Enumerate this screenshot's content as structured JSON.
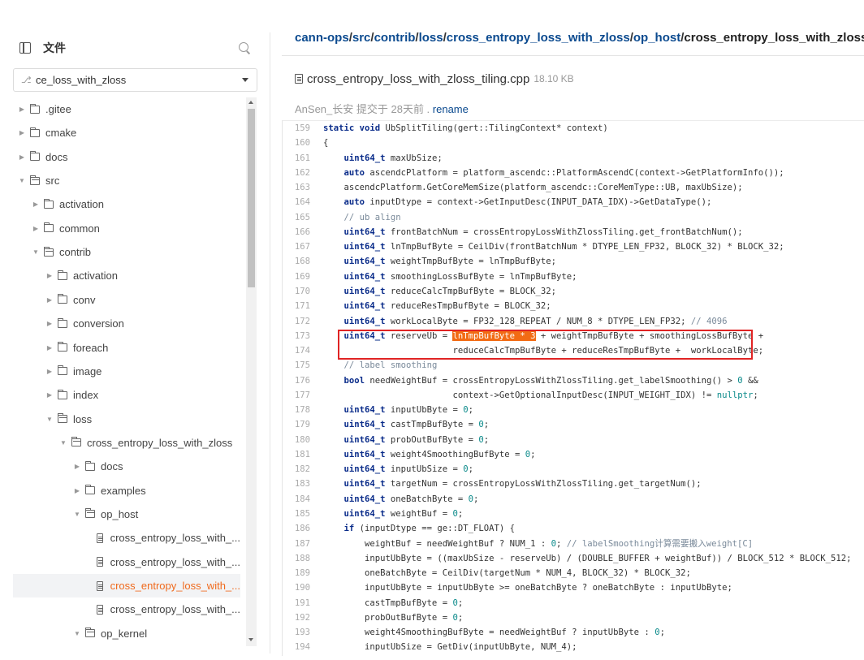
{
  "sidebar": {
    "title": "文件",
    "branch": "ce_loss_with_zloss",
    "tree": [
      {
        "label": ".gitee",
        "type": "folder",
        "open": false,
        "depth": 0
      },
      {
        "label": "cmake",
        "type": "folder",
        "open": false,
        "depth": 0
      },
      {
        "label": "docs",
        "type": "folder",
        "open": false,
        "depth": 0
      },
      {
        "label": "src",
        "type": "folder",
        "open": true,
        "depth": 0
      },
      {
        "label": "activation",
        "type": "folder",
        "open": false,
        "depth": 1
      },
      {
        "label": "common",
        "type": "folder",
        "open": false,
        "depth": 1
      },
      {
        "label": "contrib",
        "type": "folder",
        "open": true,
        "depth": 1
      },
      {
        "label": "activation",
        "type": "folder",
        "open": false,
        "depth": 2
      },
      {
        "label": "conv",
        "type": "folder",
        "open": false,
        "depth": 2
      },
      {
        "label": "conversion",
        "type": "folder",
        "open": false,
        "depth": 2
      },
      {
        "label": "foreach",
        "type": "folder",
        "open": false,
        "depth": 2
      },
      {
        "label": "image",
        "type": "folder",
        "open": false,
        "depth": 2
      },
      {
        "label": "index",
        "type": "folder",
        "open": false,
        "depth": 2
      },
      {
        "label": "loss",
        "type": "folder",
        "open": true,
        "depth": 2
      },
      {
        "label": "cross_entropy_loss_with_zloss",
        "type": "folder",
        "open": true,
        "depth": 3
      },
      {
        "label": "docs",
        "type": "folder",
        "open": false,
        "depth": 4
      },
      {
        "label": "examples",
        "type": "folder",
        "open": false,
        "depth": 4
      },
      {
        "label": "op_host",
        "type": "folder",
        "open": true,
        "depth": 4
      },
      {
        "label": "cross_entropy_loss_with_...",
        "type": "file",
        "depth": 5
      },
      {
        "label": "cross_entropy_loss_with_...",
        "type": "file",
        "depth": 5
      },
      {
        "label": "cross_entropy_loss_with_...",
        "type": "file",
        "depth": 5,
        "active": true
      },
      {
        "label": "cross_entropy_loss_with_...",
        "type": "file",
        "depth": 5
      },
      {
        "label": "op_kernel",
        "type": "folder",
        "open": true,
        "depth": 4
      }
    ]
  },
  "main": {
    "breadcrumb": [
      "cann-ops",
      "src",
      "contrib",
      "loss",
      "cross_entropy_loss_with_zloss",
      "op_host"
    ],
    "breadcrumb_current": "cross_entropy_loss_with_zloss_tiling.c",
    "file_name": "cross_entropy_loss_with_zloss_tiling.cpp",
    "file_size": "18.10 KB",
    "commit_author_time": "AnSen_长安 提交于 28天前 . ",
    "commit_message": "rename",
    "highlight_text": "lnTmpBufByte * 3",
    "code": [
      {
        "n": "159",
        "t": "<span class=\"kw\">static void</span> UbSplitTiling(gert::TilingContext* context)",
        "i": 0
      },
      {
        "n": "160",
        "t": "{",
        "i": 0
      },
      {
        "n": "161",
        "t": "<span class=\"kw\">uint64_t</span> maxUbSize;",
        "i": 1
      },
      {
        "n": "162",
        "t": "<span class=\"kw\">auto</span> ascendcPlatform = platform_ascendc::PlatformAscendC(context->GetPlatformInfo());",
        "i": 1
      },
      {
        "n": "163",
        "t": "ascendcPlatform.GetCoreMemSize(platform_ascendc::CoreMemType::UB, maxUbSize);",
        "i": 1
      },
      {
        "n": "164",
        "t": "<span class=\"kw\">auto</span> inputDtype = context->GetInputDesc(INPUT_DATA_IDX)->GetDataType();",
        "i": 1
      },
      {
        "n": "165",
        "t": "<span class=\"cm\">// ub align</span>",
        "i": 1
      },
      {
        "n": "166",
        "t": "<span class=\"kw\">uint64_t</span> frontBatchNum = crossEntropyLossWithZlossTiling.get_frontBatchNum();",
        "i": 1
      },
      {
        "n": "167",
        "t": "<span class=\"kw\">uint64_t</span> lnTmpBufByte = CeilDiv(frontBatchNum * DTYPE_LEN_FP32, BLOCK_32) * BLOCK_32;",
        "i": 1
      },
      {
        "n": "168",
        "t": "<span class=\"kw\">uint64_t</span> weightTmpBufByte = lnTmpBufByte;",
        "i": 1
      },
      {
        "n": "169",
        "t": "<span class=\"kw\">uint64_t</span> smoothingLossBufByte = lnTmpBufByte;",
        "i": 1
      },
      {
        "n": "170",
        "t": "<span class=\"kw\">uint64_t</span> reduceCalcTmpBufByte = BLOCK_32;",
        "i": 1
      },
      {
        "n": "171",
        "t": "<span class=\"kw\">uint64_t</span> reduceResTmpBufByte = BLOCK_32;",
        "i": 1
      },
      {
        "n": "172",
        "t": "<span class=\"kw\">uint64_t</span> workLocalByte = FP32_128_REPEAT / NUM_8 * DTYPE_LEN_FP32; <span class=\"cm\">// 4096</span>",
        "i": 1
      },
      {
        "n": "173",
        "t": "<span class=\"kw\">uint64_t</span> reserveUb = <span class=\"hl\">lnTmpBufByte * 3</span> + weightTmpBufByte + smoothingLossBufByte +",
        "i": 1
      },
      {
        "n": "174",
        "t": "                     reduceCalcTmpBufByte + reduceResTmpBufByte +  workLocalByte;",
        "i": 1
      },
      {
        "n": "175",
        "t": "<span class=\"cm\">// label smoothing</span>",
        "i": 1
      },
      {
        "n": "176",
        "t": "<span class=\"kw\">bool</span> needWeightBuf = crossEntropyLossWithZlossTiling.get_labelSmoothing() > <span class=\"nm\">0</span> &&",
        "i": 1
      },
      {
        "n": "177",
        "t": "                     context->GetOptionalInputDesc(INPUT_WEIGHT_IDX) != <span class=\"nm\">nullptr</span>;",
        "i": 1
      },
      {
        "n": "178",
        "t": "<span class=\"kw\">uint64_t</span> inputUbByte = <span class=\"nm\">0</span>;",
        "i": 1
      },
      {
        "n": "179",
        "t": "<span class=\"kw\">uint64_t</span> castTmpBufByte = <span class=\"nm\">0</span>;",
        "i": 1
      },
      {
        "n": "180",
        "t": "<span class=\"kw\">uint64_t</span> probOutBufByte = <span class=\"nm\">0</span>;",
        "i": 1
      },
      {
        "n": "181",
        "t": "<span class=\"kw\">uint64_t</span> weight4SmoothingBufByte = <span class=\"nm\">0</span>;",
        "i": 1
      },
      {
        "n": "182",
        "t": "<span class=\"kw\">uint64_t</span> inputUbSize = <span class=\"nm\">0</span>;",
        "i": 1
      },
      {
        "n": "183",
        "t": "<span class=\"kw\">uint64_t</span> targetNum = crossEntropyLossWithZlossTiling.get_targetNum();",
        "i": 1
      },
      {
        "n": "184",
        "t": "<span class=\"kw\">uint64_t</span> oneBatchByte = <span class=\"nm\">0</span>;",
        "i": 1
      },
      {
        "n": "185",
        "t": "<span class=\"kw\">uint64_t</span> weightBuf = <span class=\"nm\">0</span>;",
        "i": 1
      },
      {
        "n": "186",
        "t": "<span class=\"kw\">if</span> (inputDtype == ge::DT_FLOAT) {",
        "i": 1
      },
      {
        "n": "187",
        "t": "weightBuf = needWeightBuf ? NUM_1 : <span class=\"nm\">0</span>; <span class=\"cm\">// labelSmoothing计算需要搬入weight[C]</span>",
        "i": 2
      },
      {
        "n": "188",
        "t": "inputUbByte = ((maxUbSize - reserveUb) / (DOUBLE_BUFFER + weightBuf)) / BLOCK_512 * BLOCK_512;",
        "i": 2
      },
      {
        "n": "189",
        "t": "oneBatchByte = CeilDiv(targetNum * NUM_4, BLOCK_32) * BLOCK_32;",
        "i": 2
      },
      {
        "n": "190",
        "t": "inputUbByte = inputUbByte >= oneBatchByte ? oneBatchByte : inputUbByte;",
        "i": 2
      },
      {
        "n": "191",
        "t": "castTmpBufByte = <span class=\"nm\">0</span>;",
        "i": 2
      },
      {
        "n": "192",
        "t": "probOutBufByte = <span class=\"nm\">0</span>;",
        "i": 2
      },
      {
        "n": "193",
        "t": "weight4SmoothingBufByte = needWeightBuf ? inputUbByte : <span class=\"nm\">0</span>;",
        "i": 2
      },
      {
        "n": "194",
        "t": "inputUbSize = GetDiv(inputUbByte, NUM_4);",
        "i": 2
      }
    ]
  }
}
